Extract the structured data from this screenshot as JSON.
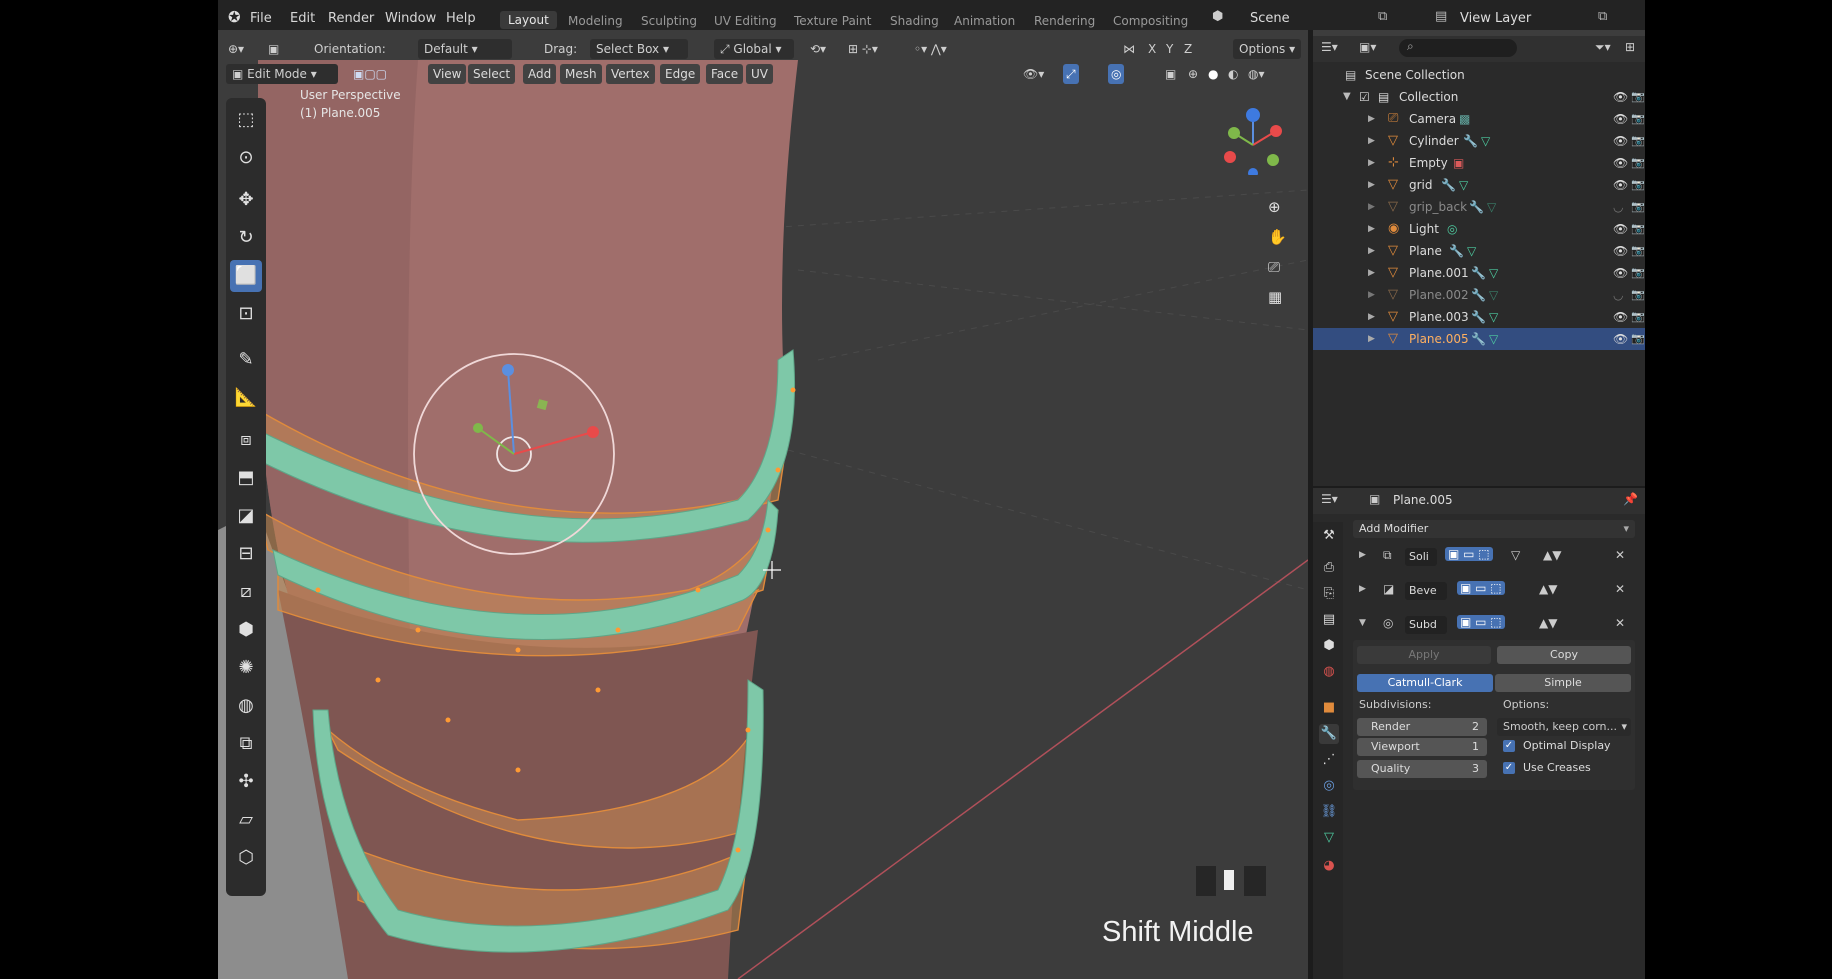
{
  "topbar": {
    "menus": [
      "File",
      "Edit",
      "Render",
      "Window",
      "Help"
    ],
    "workspaces": [
      "Layout",
      "Modeling",
      "Sculpting",
      "UV Editing",
      "Texture Paint",
      "Shading",
      "Animation",
      "Rendering",
      "Compositing"
    ],
    "active_workspace": "Layout",
    "scene": "Scene",
    "view_layer": "View Layer"
  },
  "header": {
    "orientation_label": "Orientation:",
    "orientation_value": "Default",
    "drag_label": "Drag:",
    "drag_value": "Select Box",
    "transform_orientation": "Global",
    "options": "Options",
    "axes": [
      "X",
      "Y",
      "Z"
    ]
  },
  "header2": {
    "mode": "Edit Mode",
    "menus": [
      "View",
      "Select",
      "Add",
      "Mesh",
      "Vertex",
      "Edge",
      "Face",
      "UV"
    ]
  },
  "viewport": {
    "view_name": "User Perspective",
    "object_info": "(1) Plane.005",
    "key_caption": "Shift Middle"
  },
  "outliner": {
    "root": "Scene Collection",
    "collection": "Collection",
    "items": [
      {
        "name": "Camera",
        "icon": "camera-icon",
        "dim": false
      },
      {
        "name": "Cylinder",
        "icon": "mesh-icon",
        "dim": false
      },
      {
        "name": "Empty",
        "icon": "empty-icon",
        "dim": false
      },
      {
        "name": "grid",
        "icon": "mesh-icon",
        "dim": false
      },
      {
        "name": "grip_back",
        "icon": "mesh-icon",
        "dim": true
      },
      {
        "name": "Light",
        "icon": "light-icon",
        "dim": false
      },
      {
        "name": "Plane",
        "icon": "mesh-icon",
        "dim": false
      },
      {
        "name": "Plane.001",
        "icon": "mesh-icon",
        "dim": false
      },
      {
        "name": "Plane.002",
        "icon": "mesh-icon",
        "dim": true
      },
      {
        "name": "Plane.003",
        "icon": "mesh-icon",
        "dim": false
      },
      {
        "name": "Plane.005",
        "icon": "mesh-icon",
        "dim": false
      }
    ]
  },
  "properties": {
    "object_name": "Plane.005",
    "add_modifier": "Add Modifier",
    "modifiers": [
      "Soli",
      "Beve",
      "Subd"
    ],
    "apply": "Apply",
    "copy": "Copy",
    "catmull": "Catmull-Clark",
    "simple": "Simple",
    "subdivisions_label": "Subdivisions:",
    "options_label": "Options:",
    "render_label": "Render",
    "render_value": "2",
    "viewport_label": "Viewport",
    "viewport_value": "1",
    "quality_label": "Quality",
    "quality_value": "3",
    "uv_smooth": "Smooth, keep corn...",
    "optimal_display": "Optimal Display",
    "use_creases": "Use Creases"
  },
  "colors": {
    "accent": "#4772b3",
    "selection": "#334d80",
    "mesh_orange": "#e08b3c",
    "band_green": "#7ec8a8",
    "body_pink": "#a7726f"
  }
}
